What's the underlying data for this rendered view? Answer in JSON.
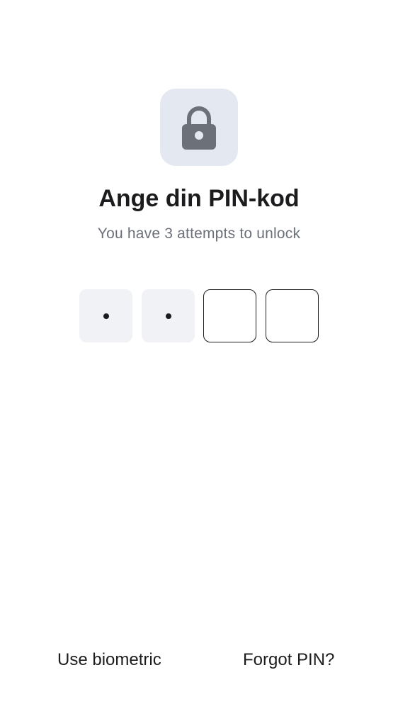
{
  "header": {
    "icon": "lock-icon",
    "icon_colors": {
      "tile_background": "#e4e8f1",
      "glyph": "#6b7079"
    },
    "title": "Ange din PIN-kod",
    "subtitle": "You have 3 attempts to unlock"
  },
  "pin": {
    "length": 4,
    "entered_count": 2,
    "cells": [
      {
        "state": "filled",
        "mask": "•"
      },
      {
        "state": "filled",
        "mask": "•"
      },
      {
        "state": "empty",
        "mask": ""
      },
      {
        "state": "empty",
        "mask": ""
      }
    ]
  },
  "footer": {
    "biometric_label": "Use biometric",
    "forgot_label": "Forgot PIN?"
  }
}
